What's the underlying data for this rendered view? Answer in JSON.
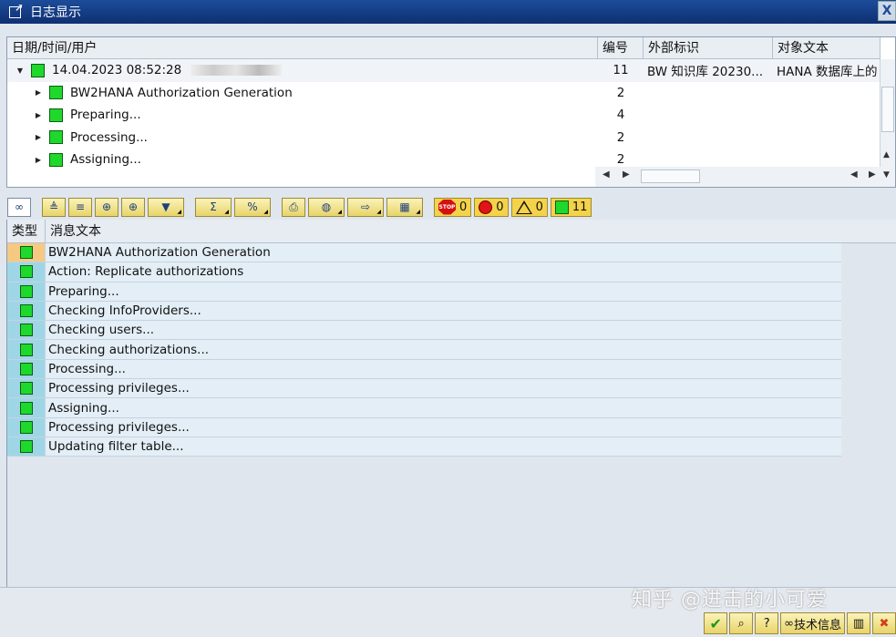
{
  "window": {
    "title": "日志显示",
    "close_glyph": "X"
  },
  "tree": {
    "headers": [
      "日期/时间/用户",
      "编号",
      "外部标识",
      "对象文本"
    ],
    "rows": [
      {
        "expand": "▼",
        "label": "14.04.2023  08:52:28",
        "num": "11",
        "ext": "BW 知识库 20230...",
        "obj": "HANA 数据库上的"
      },
      {
        "expand": "▶",
        "label": "BW2HANA Authorization Generation",
        "num": "2",
        "ext": "",
        "obj": ""
      },
      {
        "expand": "▶",
        "label": "Preparing...",
        "num": "4",
        "ext": "",
        "obj": ""
      },
      {
        "expand": "▶",
        "label": "Processing...",
        "num": "2",
        "ext": "",
        "obj": ""
      },
      {
        "expand": "▶",
        "label": "Assigning...",
        "num": "2",
        "ext": "",
        "obj": ""
      }
    ]
  },
  "toolbar": {
    "stop_label": "STOP",
    "stop_count": "0",
    "error_count": "0",
    "warning_count": "0",
    "success_count": "11"
  },
  "messages": {
    "headers": [
      "类型",
      "消息文本"
    ],
    "rows": [
      "BW2HANA Authorization Generation",
      "Action: Replicate authorizations",
      "Preparing...",
      "Checking InfoProviders...",
      "Checking users...",
      "Checking authorizations...",
      "Processing...",
      "Processing privileges...",
      "Assigning...",
      "Processing privileges...",
      "Updating filter table..."
    ]
  },
  "bottom": {
    "tech_info_label": "技术信息"
  },
  "watermark": "知乎 @进击的小可爱"
}
